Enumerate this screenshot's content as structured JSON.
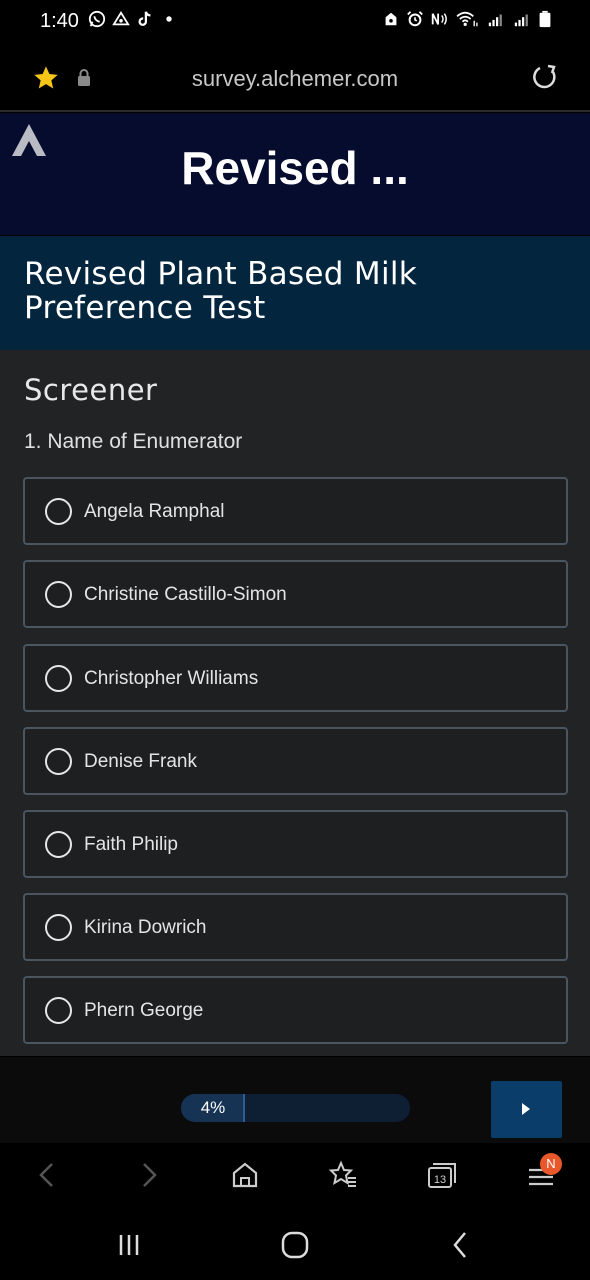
{
  "status_bar": {
    "time": "1:40"
  },
  "browser": {
    "url": "survey.alchemer.com",
    "tab_count": "13",
    "menu_badge": "N"
  },
  "survey": {
    "header_title": "Revised ...",
    "full_title": "Revised Plant Based Milk Preference Test",
    "page_title": "Screener",
    "question": "1. Name of Enumerator",
    "options": [
      {
        "label": "Angela Ramphal"
      },
      {
        "label": "Christine Castillo-Simon"
      },
      {
        "label": "Christopher Williams"
      },
      {
        "label": "Denise Frank"
      },
      {
        "label": "Faith Philip"
      },
      {
        "label": "Kirina Dowrich"
      },
      {
        "label": "Phern George"
      }
    ],
    "progress_label": "4%",
    "progress_value": 0.04
  },
  "colors": {
    "header_bg": "#050c2e",
    "title_band_bg": "#04253e",
    "content_bg": "#222325",
    "next_button_bg": "#0b3d6a",
    "badge": "#e8582a",
    "star": "#f5c518"
  }
}
